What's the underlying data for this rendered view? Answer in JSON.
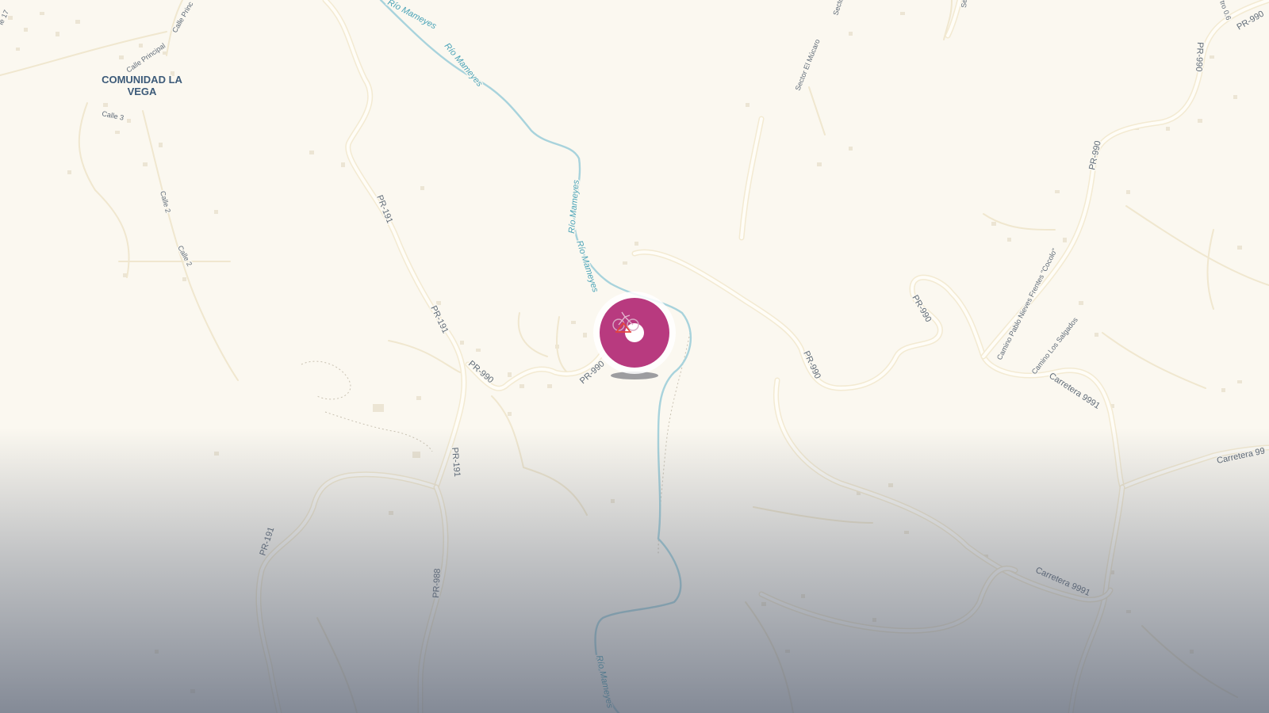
{
  "map": {
    "place_label": [
      "COMUNIDAD LA",
      "VEGA"
    ],
    "road_labels": {
      "pr191_a": "PR-191",
      "pr191_b": "PR-191",
      "pr191_c": "PR-191",
      "pr191_d": "PR-191",
      "pr988": "PR-988",
      "pr990_a": "PR-990",
      "pr990_b": "PR-990",
      "pr990_c": "PR-990",
      "pr990_d": "PR-990",
      "pr990_e": "PR-990",
      "pr990_f": "PR-990",
      "pr990_g": "PR-990",
      "carretera9991_a": "Carretera 9991",
      "carretera9991_b": "Carretera 9991",
      "carretera99_edge": "Carretera 99",
      "calle_principal_a": "Calle Principal",
      "calle_principal_b": "Calle Princ",
      "calle17": "le 17",
      "calle3": "Calle 3",
      "calle2_a": "Calle 2",
      "calle2_b": "Calle 2",
      "sector_el_mucaro": "Sector El Múcaro",
      "sector_top": "Secto",
      "sec_top": "Sec",
      "tro06": "tro 0.6",
      "pablo_nieves": "Camino Pablo Nieves Frentes \"Cocolo\"",
      "los_salgados": "Camino Los Salgados"
    },
    "river_labels": {
      "a": "Río Mameyes",
      "b": "Río Mameyes",
      "c": "Río Mameyes",
      "d": "Río Mameyes",
      "e": "Río Mameyes"
    },
    "marker": {
      "icon": "cyclist-icon",
      "color": "#b83a7f"
    }
  }
}
